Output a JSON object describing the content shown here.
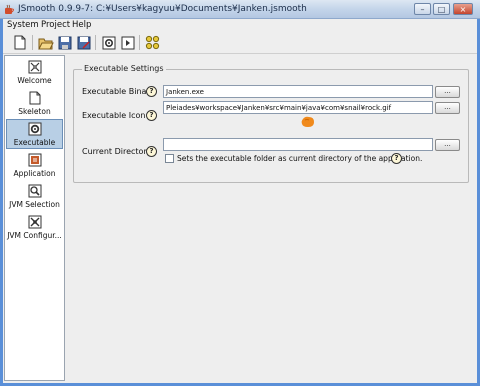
{
  "window": {
    "title": "JSmooth 0.9.9-7: C:¥Users¥kagyuu¥Documents¥Janken.jsmooth",
    "minimize_label": "–",
    "maximize_label": "□",
    "close_label": "×"
  },
  "menu": [
    "System",
    "Project",
    "Help"
  ],
  "toolbar": {
    "buttons": [
      "new-document-icon",
      "open-folder-icon",
      "save-icon",
      "save-as-icon",
      "compile-icon",
      "run-icon",
      "skeleton-icon"
    ]
  },
  "nav": {
    "items": [
      {
        "label": "Welcome",
        "icon": "welcome-icon"
      },
      {
        "label": "Skeleton",
        "icon": "skeleton-page-icon"
      },
      {
        "label": "Executable",
        "icon": "executable-gear-icon",
        "selected": true
      },
      {
        "label": "Application",
        "icon": "application-icon"
      },
      {
        "label": "JVM Selection",
        "icon": "jvm-selection-icon"
      },
      {
        "label": "JVM Configur...",
        "icon": "jvm-configuration-icon"
      }
    ]
  },
  "executable": {
    "group_title": "Executable Settings",
    "binary_label": "Executable Binary",
    "binary_value": "Janken.exe",
    "icon_label": "Executable Icon",
    "icon_value": "Pleiades¥workspace¥Janken¥src¥main¥java¥com¥snail¥rock.gif",
    "current_dir_label": "Current Directory",
    "current_dir_value": "",
    "current_dir_checkbox_label": "Sets the executable folder as current directory of the application.",
    "current_dir_checked": false,
    "browse_label": "...",
    "help_glyph": "?"
  },
  "colors": {
    "selected_nav": "#b8cfe5",
    "icon_preview": "#f08a1c"
  }
}
